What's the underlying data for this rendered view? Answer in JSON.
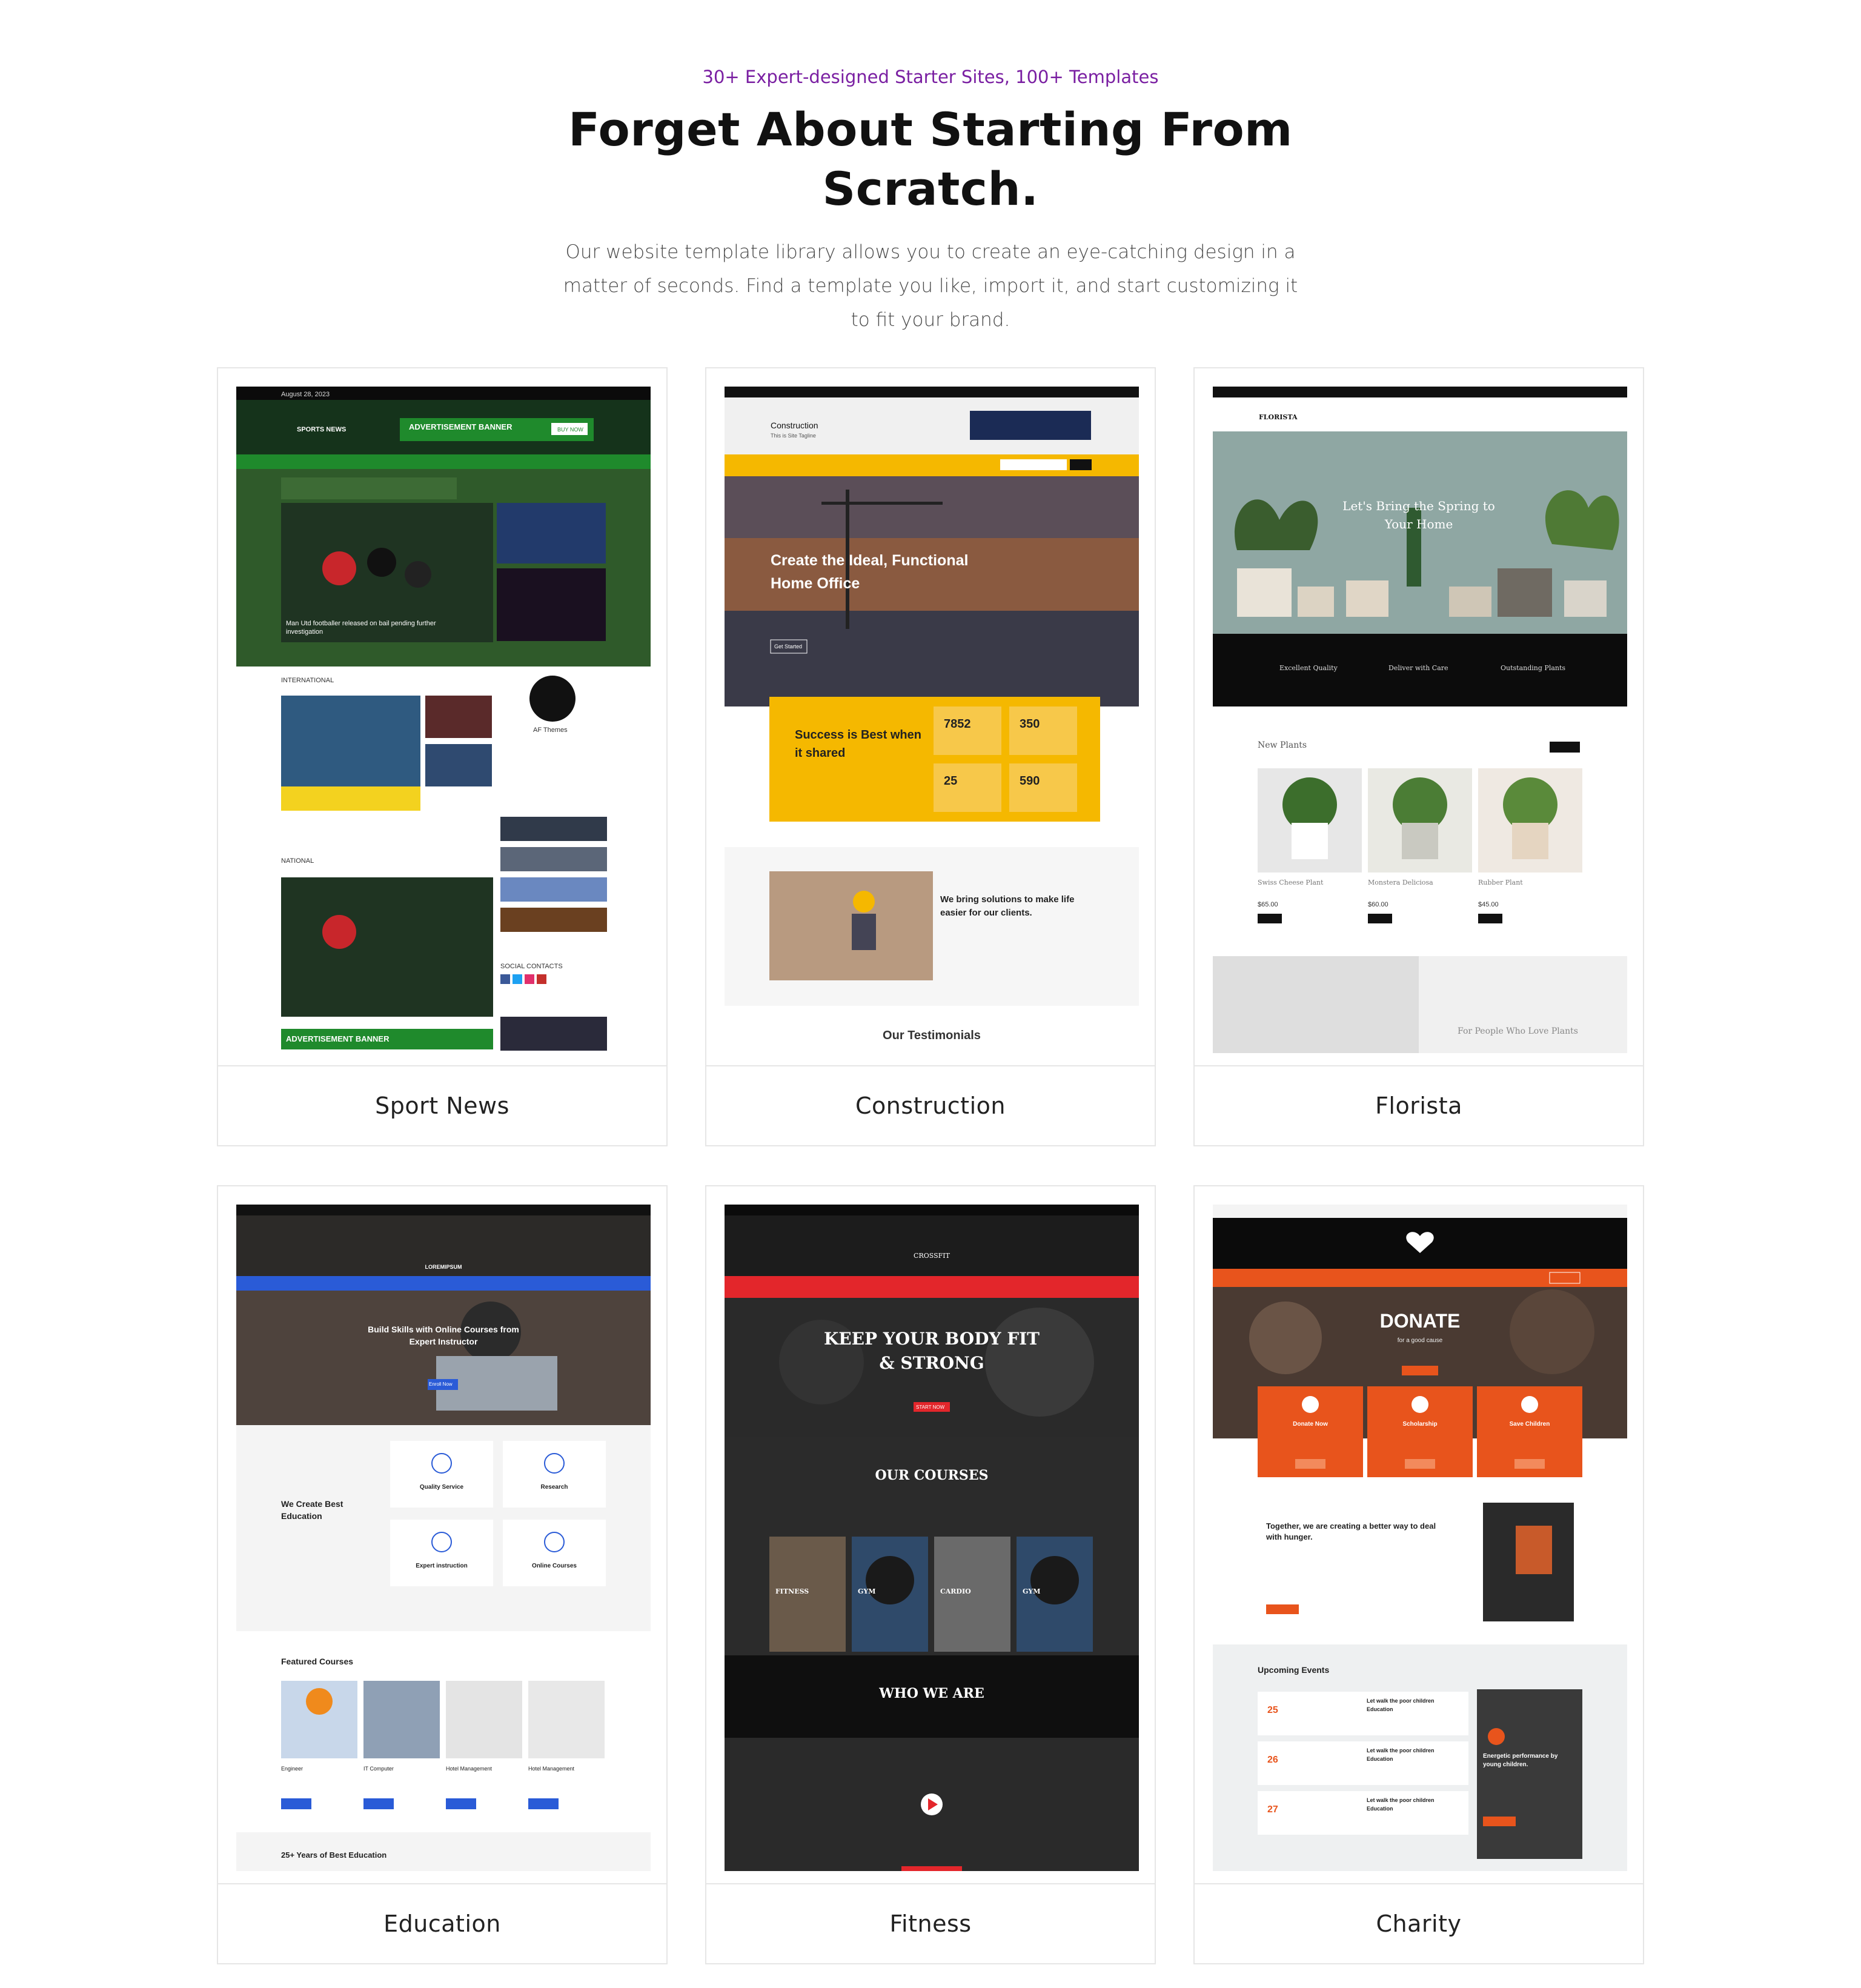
{
  "hero": {
    "eyebrow": "30+ Expert-designed Starter Sites, 100+ Templates",
    "title": "Forget About Starting From Scratch.",
    "description": "Our website template library allows you to create an eye-catching design in a matter of seconds. Find a template you like, import it, and start customizing it to fit your brand."
  },
  "cards": [
    {
      "label": "Sport News",
      "preview": {
        "date": "August 28, 2023",
        "brand": "SPORTS NEWS",
        "banner": "ADVERTISEMENT BANNER",
        "buy": "BUY NOW",
        "headline": "Man Utd footballer released on bail pending further investigation",
        "section_intl": "INTERNATIONAL",
        "section_national": "NATIONAL",
        "profile_name": "AF Themes",
        "social": "SOCIAL CONTACTS"
      }
    },
    {
      "label": "Construction",
      "preview": {
        "brand": "Construction",
        "tagline": "This is Site Tagline",
        "hero_title": "Create the Ideal, Functional Home Office",
        "cta": "Get Started",
        "success": "Success is Best when it shared",
        "stats": [
          "7852",
          "350",
          "25",
          "590"
        ],
        "solutions": "We bring solutions to make life easier for our clients.",
        "testimonials": "Our Testimonials"
      }
    },
    {
      "label": "Florista",
      "preview": {
        "brand": "FLORISTA",
        "hero_title": "Let's Bring the Spring to Your Home",
        "features": [
          "Excellent Quality",
          "Deliver with Care",
          "Outstanding Plants"
        ],
        "new_plants": "New Plants",
        "plants": [
          "Swiss Cheese Plant",
          "Monstera Deliciosa",
          "Rubber Plant"
        ],
        "prices": [
          "$65.00",
          "$60.00",
          "$45.00"
        ],
        "story": "For People Who Love Plants"
      }
    },
    {
      "label": "Education",
      "preview": {
        "brand": "LOREMIPSUM",
        "hero_title": "Build Skills with Online Courses from Expert Instructor",
        "enroll": "Enroll Now",
        "create": "We Create Best Education",
        "services": [
          "Quality Service",
          "Research",
          "Expert instruction",
          "Online Courses"
        ],
        "featured": "Featured Courses",
        "courses": [
          "Engineer",
          "IT Computer",
          "Hotel Management",
          "Hotel Management"
        ],
        "years": "25+ Years of Best Education"
      }
    },
    {
      "label": "Fitness",
      "preview": {
        "brand": "CROSSFIT",
        "hero_title": "KEEP YOUR BODY FIT & STRONG",
        "start": "START NOW",
        "courses_title": "OUR COURSES",
        "courses": [
          "FITNESS",
          "GYM",
          "CARDIO",
          "GYM"
        ],
        "who": "WHO WE ARE"
      }
    },
    {
      "label": "Charity",
      "preview": {
        "hero_title": "DONATE",
        "hero_sub": "for a good cause",
        "boxes": [
          "Donate Now",
          "Scholarship",
          "Save Children"
        ],
        "together": "Together, we are creating a better way to deal with hunger.",
        "events_title": "Upcoming Events",
        "event_days": [
          "25",
          "26",
          "27"
        ],
        "event_name": "Let walk the poor children Education",
        "side_title": "Energetic performance by young children."
      }
    }
  ],
  "colors": {
    "eyebrow": "#7a1fa2",
    "sport_green": "#1f8a2c",
    "construction_yellow": "#f5b800",
    "florista_green": "#6f8f8a",
    "education_blue": "#2a5bd7",
    "fitness_red": "#e3262b",
    "charity_orange": "#e8541c"
  }
}
